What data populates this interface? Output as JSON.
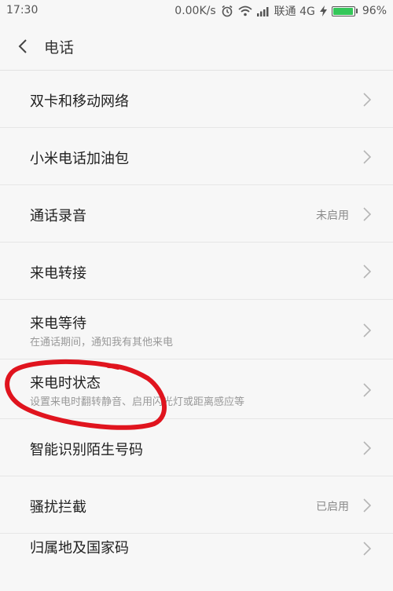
{
  "status": {
    "time": "17:30",
    "speed": "0.00K/s",
    "carrier": "联通 4G",
    "battery": "96%",
    "battery_level": 0.96
  },
  "header": {
    "title": "电话"
  },
  "rows": [
    {
      "title": "双卡和移动网络"
    },
    {
      "title": "小米电话加油包"
    },
    {
      "title": "通话录音",
      "value": "未启用"
    },
    {
      "title": "来电转接"
    },
    {
      "title": "来电等待",
      "subtitle": "在通话期间，通知我有其他来电"
    },
    {
      "title": "来电时状态",
      "subtitle": "设置来电时翻转静音、启用闪光灯或距离感应等"
    },
    {
      "title": "智能识别陌生号码"
    },
    {
      "title": "骚扰拦截",
      "value": "已启用"
    },
    {
      "title": "归属地及国家码"
    }
  ],
  "icons": {
    "back": "chevron-left-icon",
    "row_arrow": "chevron-right-icon",
    "alarm": "alarm-clock-icon",
    "wifi": "wifi-icon",
    "signal": "signal-bars-icon",
    "charging": "lightning-icon"
  },
  "colors": {
    "annotation_circle": "#e0141e",
    "battery_fill": "#34c759"
  }
}
